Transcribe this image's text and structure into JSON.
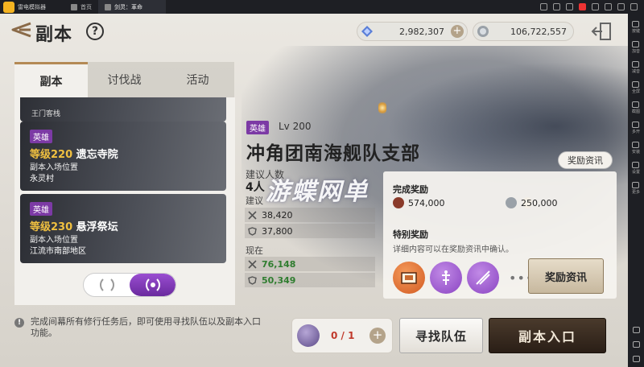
{
  "emulator": {
    "app_name": "雷电模拟器",
    "tabs": [
      {
        "label": "首页"
      },
      {
        "label": "剑灵：革命"
      }
    ],
    "sidebar": [
      {
        "label": "按键"
      },
      {
        "label": "加音"
      },
      {
        "label": "减音"
      },
      {
        "label": "全屏"
      },
      {
        "label": "截图"
      },
      {
        "label": "多开"
      },
      {
        "label": "安装"
      },
      {
        "label": "设置"
      },
      {
        "label": "更多"
      }
    ]
  },
  "header": {
    "title": "副本",
    "help": "?",
    "currency_1": {
      "value": "2,982,307",
      "plus": "+"
    },
    "currency_2": {
      "value": "106,722,557"
    }
  },
  "tabs": [
    {
      "label": "副本"
    },
    {
      "label": "讨伐战"
    },
    {
      "label": "活动"
    }
  ],
  "dungeon_list": {
    "partial_top": "王门客栈",
    "items": [
      {
        "badge": "英雄",
        "level": "等级220",
        "name": "遗忘寺院",
        "sub": "副本入场位置",
        "location": "永灵村"
      },
      {
        "badge": "英雄",
        "level": "等级230",
        "name": "悬浮祭坛",
        "sub": "副本入场位置",
        "location": "江流市南部地区"
      }
    ]
  },
  "detail": {
    "badge": "英雄",
    "level": "Lv 200",
    "title": "冲角团南海舰队支部",
    "recommend_people_label": "建议人数",
    "recommend_people": "4人",
    "recommend_label": "建议",
    "recommend_attack": "38,420",
    "recommend_defense": "37,800",
    "current_label": "现在",
    "current_attack": "76,148",
    "current_defense": "50,349"
  },
  "reward": {
    "info_tag": "奖励资讯",
    "complete_title": "完成奖励",
    "exp": "574,000",
    "silver": "250,000",
    "special_title": "特别奖励",
    "special_desc": "详细内容可以在奖励资讯中确认。",
    "more": "•••",
    "button": "奖励资讯"
  },
  "bottom": {
    "notice_icon": "!",
    "notice": "完成间幕所有修行任务后，即可使用寻找队伍以及副本入口功能。",
    "ticket_count": "0 / 1",
    "ticket_plus": "+",
    "find_team": "寻找队伍",
    "enter": "副本入口"
  },
  "watermark": "游蝶网单",
  "colors": {
    "hero_badge": "#7c3aa5",
    "level_gold": "#f0c040",
    "current_green": "#2f7d2f",
    "enter_button": "#2a1e16"
  }
}
